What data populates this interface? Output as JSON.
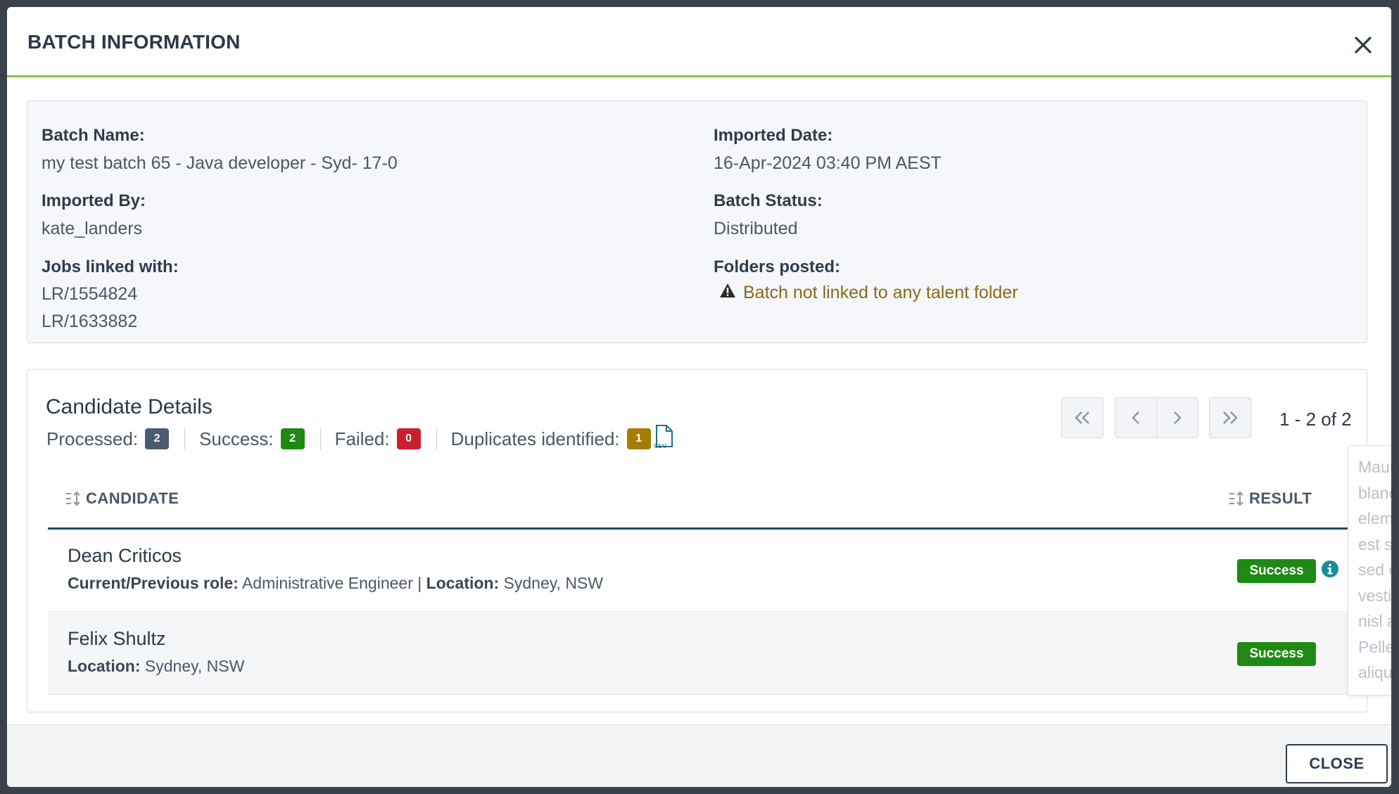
{
  "dialog": {
    "title": "BATCH INFORMATION",
    "close_button": "CLOSE"
  },
  "batch": {
    "name_label": "Batch Name:",
    "name_value": "my test batch 65 - Java developer - Syd- 17-0",
    "imported_date_label": "Imported Date:",
    "imported_date_value": "16-Apr-2024 03:40 PM AEST",
    "imported_by_label": "Imported By:",
    "imported_by_value": "kate_landers",
    "status_label": "Batch Status:",
    "status_value": "Distributed",
    "jobs_label": "Jobs linked with:",
    "jobs": [
      "LR/1554824",
      "LR/1633882"
    ],
    "folders_label": "Folders posted:",
    "folders_warning": "Batch not linked to any talent folder"
  },
  "candidates": {
    "title": "Candidate Details",
    "stats": [
      {
        "label": "Processed:",
        "count": "2",
        "color": "#4a5a70"
      },
      {
        "label": "Success:",
        "count": "2",
        "color": "#1e8a14"
      },
      {
        "label": "Failed:",
        "count": "0",
        "color": "#cc1f2d"
      },
      {
        "label": "Duplicates identified:",
        "count": "1",
        "color": "#a67c00"
      }
    ],
    "csv_icon_label": "csv",
    "pagination": "1 - 2 of 2",
    "columns": {
      "candidate": "CANDIDATE",
      "result": "RESULT"
    },
    "rows": [
      {
        "name": "Dean Criticos",
        "role_label": "Current/Previous role:",
        "role_value": "Administrative Engineer",
        "location_label": "Location:",
        "location_value": "Sydney, NSW",
        "result": "Success"
      },
      {
        "name": "Felix Shultz",
        "location_label": "Location:",
        "location_value": "Sydney, NSW",
        "result": "Success"
      }
    ],
    "tooltip_lines": [
      "Maur",
      "bland",
      "eleme",
      "est se",
      "sed c",
      "vestib",
      "nisl a",
      "Peller",
      "aliqu"
    ]
  },
  "colors": {
    "accent": "#8dc63f",
    "header_line": "#1f4e6b",
    "success": "#1e8a14",
    "warning_text": "#8a6a1b"
  }
}
